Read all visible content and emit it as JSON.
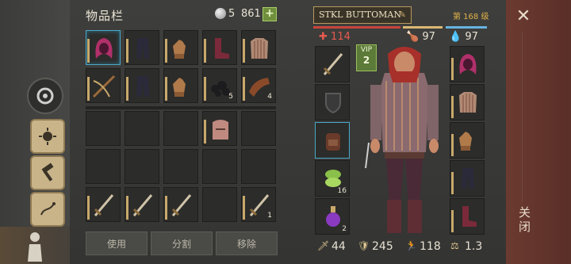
{
  "inventory": {
    "title": "物品栏",
    "silver": "5",
    "gold": "861",
    "plus": "+"
  },
  "slots": [
    {
      "icon": "hood-icon",
      "count": ""
    },
    {
      "icon": "pants-icon",
      "count": ""
    },
    {
      "icon": "gloves-icon",
      "count": ""
    },
    {
      "icon": "boots-icon",
      "count": ""
    },
    {
      "icon": "chainmail-icon",
      "count": ""
    },
    {
      "icon": "crossbow-icon",
      "count": ""
    },
    {
      "icon": "pants-icon",
      "count": ""
    },
    {
      "icon": "gloves-icon",
      "count": ""
    },
    {
      "icon": "coal-icon",
      "count": "5"
    },
    {
      "icon": "leather-icon",
      "count": "4"
    },
    {
      "icon": "",
      "count": ""
    },
    {
      "icon": "",
      "count": ""
    },
    {
      "icon": "",
      "count": ""
    },
    {
      "icon": "helmet-icon",
      "count": ""
    },
    {
      "icon": "",
      "count": ""
    },
    {
      "icon": "",
      "count": ""
    },
    {
      "icon": "",
      "count": ""
    },
    {
      "icon": "",
      "count": ""
    },
    {
      "icon": "",
      "count": ""
    },
    {
      "icon": "",
      "count": ""
    },
    {
      "icon": "sword-icon",
      "count": ""
    },
    {
      "icon": "sword-icon",
      "count": ""
    },
    {
      "icon": "sword-icon",
      "count": ""
    },
    {
      "icon": "",
      "count": ""
    },
    {
      "icon": "sword-icon",
      "count": "1"
    }
  ],
  "actions": {
    "use": "使用",
    "split": "分割",
    "remove": "移除"
  },
  "character": {
    "name": "STKL BUTTOMAN",
    "level": "第 168 级",
    "hp": "114",
    "food": "97",
    "water": "97",
    "vip_label": "VIP",
    "vip_level": "2",
    "left_slots": [
      {
        "icon": "sword-icon",
        "count": ""
      },
      {
        "icon": "shield-icon",
        "count": ""
      },
      {
        "icon": "backpack-icon",
        "count": ""
      },
      {
        "icon": "bandage-icon",
        "count": "16"
      },
      {
        "icon": "potion-icon",
        "count": "2"
      }
    ],
    "right_slots": [
      {
        "icon": "hood-icon"
      },
      {
        "icon": "chainmail-icon"
      },
      {
        "icon": "gloves-icon"
      },
      {
        "icon": "pants-icon"
      },
      {
        "icon": "boots-icon"
      }
    ],
    "stats": {
      "attack": "44",
      "armor": "245",
      "speed": "118",
      "weight": "1.3"
    }
  },
  "close": {
    "label": "关闭",
    "x": "✕"
  },
  "colors": {
    "hp": "#c8453d",
    "food": "#d9b873",
    "water": "#66b4e0",
    "accent": "#c8a86b"
  }
}
